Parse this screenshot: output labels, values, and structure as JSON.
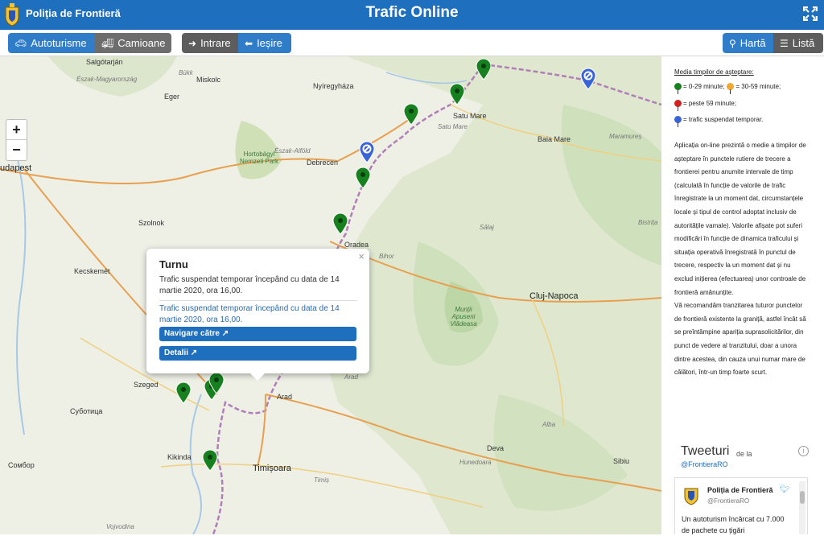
{
  "header": {
    "brand": "Poliția de Frontieră",
    "title": "Trafic Online",
    "fullscreen_icon": "expand-icon"
  },
  "toolbar": {
    "autoturisme": "Autoturisme",
    "camioane": "Camioane",
    "intrare": "Intrare",
    "iesire": "Ieșire",
    "harta": "Hartă",
    "lista": "Listă"
  },
  "map": {
    "zoom_in": "+",
    "zoom_out": "−",
    "labels": [
      {
        "t": "Salgótarján",
        "cls": "city"
      },
      {
        "t": "Észak-Magyarország",
        "cls": "ital"
      },
      {
        "t": "Bükk",
        "cls": "ital"
      },
      {
        "t": "Miskolc",
        "cls": "city"
      },
      {
        "t": "Eger",
        "cls": "city"
      },
      {
        "t": "Nyíregyháza",
        "cls": "city"
      },
      {
        "t": "Satu Mare",
        "cls": "city"
      },
      {
        "t": "Satu Mare",
        "cls": "ital"
      },
      {
        "t": "Baia Mare",
        "cls": "city"
      },
      {
        "t": "Maramureș",
        "cls": "ital"
      },
      {
        "t": "Hortobágyi Nemzeti Park",
        "cls": "park"
      },
      {
        "t": "Észak-Alföld",
        "cls": "ital"
      },
      {
        "t": "Debrecen",
        "cls": "city"
      },
      {
        "t": "udapest",
        "cls": "big"
      },
      {
        "t": "Szolnok",
        "cls": "city"
      },
      {
        "t": "Kecskemét",
        "cls": "city"
      },
      {
        "t": "Oradea",
        "cls": "city"
      },
      {
        "t": "Bihor",
        "cls": "ital"
      },
      {
        "t": "Sălaj",
        "cls": "ital"
      },
      {
        "t": "Bistrița",
        "cls": "ital"
      },
      {
        "t": "Cluj-Napoca",
        "cls": "big"
      },
      {
        "t": "Munții Apuseni Vlădeasa",
        "cls": "park"
      },
      {
        "t": "Arad",
        "cls": "ital"
      },
      {
        "t": "Szeged",
        "cls": "city"
      },
      {
        "t": "Arad",
        "cls": "city"
      },
      {
        "t": "Суботица",
        "cls": "city"
      },
      {
        "t": "Alba",
        "cls": "ital"
      },
      {
        "t": "Kikinda",
        "cls": "city"
      },
      {
        "t": "Timișoara",
        "cls": "big"
      },
      {
        "t": "Deva",
        "cls": "city"
      },
      {
        "t": "Hunedoara",
        "cls": "ital"
      },
      {
        "t": "Sibiu",
        "cls": "city"
      },
      {
        "t": "Сомбор",
        "cls": "city"
      },
      {
        "t": "Timiș",
        "cls": "ital"
      },
      {
        "t": "Vojvodina",
        "cls": "ital"
      }
    ],
    "markers": [
      {
        "color": "#17801f"
      },
      {
        "color": "#17801f"
      },
      {
        "color": "#17801f"
      },
      {
        "color": "#3a63d8"
      },
      {
        "color": "#3a63d8"
      },
      {
        "color": "#17801f"
      },
      {
        "color": "#17801f"
      },
      {
        "color": "#17801f"
      },
      {
        "color": "#17801f"
      },
      {
        "color": "#17801f"
      },
      {
        "color": "#17801f"
      }
    ]
  },
  "popup": {
    "close": "×",
    "title": "Turnu",
    "text": "Trafic suspendat temporar începând cu data de 14 martie 2020, ora 16,00.",
    "text2": "Trafic suspendat temporar începând cu data de 14 martie 2020, ora 16,00.",
    "nav_button": "Navigare către ↗",
    "details_button": "Detalii ↗"
  },
  "sidebar": {
    "legend_title": "Media timpilor de așteptare:",
    "legend": [
      {
        "text": "= 0-29 minute;",
        "color": "#17801f"
      },
      {
        "text": "= 30-59 minute;",
        "color": "#f0a830"
      },
      {
        "text": "= peste 59 minute;",
        "color": "#d42020"
      },
      {
        "text": "= trafic suspendat temporar.",
        "color": "#3a63d8"
      }
    ],
    "description": "Aplicația on-line prezintă o medie a timpilor de așteptare în punctele rutiere de trecere a frontierei pentru anumite intervale de timp (calculată în funcție de valorile de trafic înregistrate la un moment dat, circumstanțele locale și tipul de control adoptat inclusiv de autoritățile vamale). Valorile afișate pot suferi modificări în funcție de dinamica traficului și situația operativă înregistrată în punctul de trecere, respectiv la un moment dat și nu exclud inițierea (efectuarea) unor controale de frontieră amănunțite.",
    "description2": "Vă recomandăm tranzitarea tuturor punctelor de frontieră existente la graniță, astfel încât să se preîntâmpine apariția suprasolicitărilor, din punct de vedere al tranzitului, doar a unora dintre acestea, din cauza unui numar mare de călători, într-un timp foarte scurt.",
    "tweets": {
      "title": "Tweeturi",
      "de": "de la",
      "handle": "@FrontieraRO",
      "info": "i",
      "author": "Poliția de Frontieră",
      "author_handle": "@FrontieraRO",
      "body": "Un autoturism încărcat cu 7.000 de pachete cu țigări"
    }
  }
}
